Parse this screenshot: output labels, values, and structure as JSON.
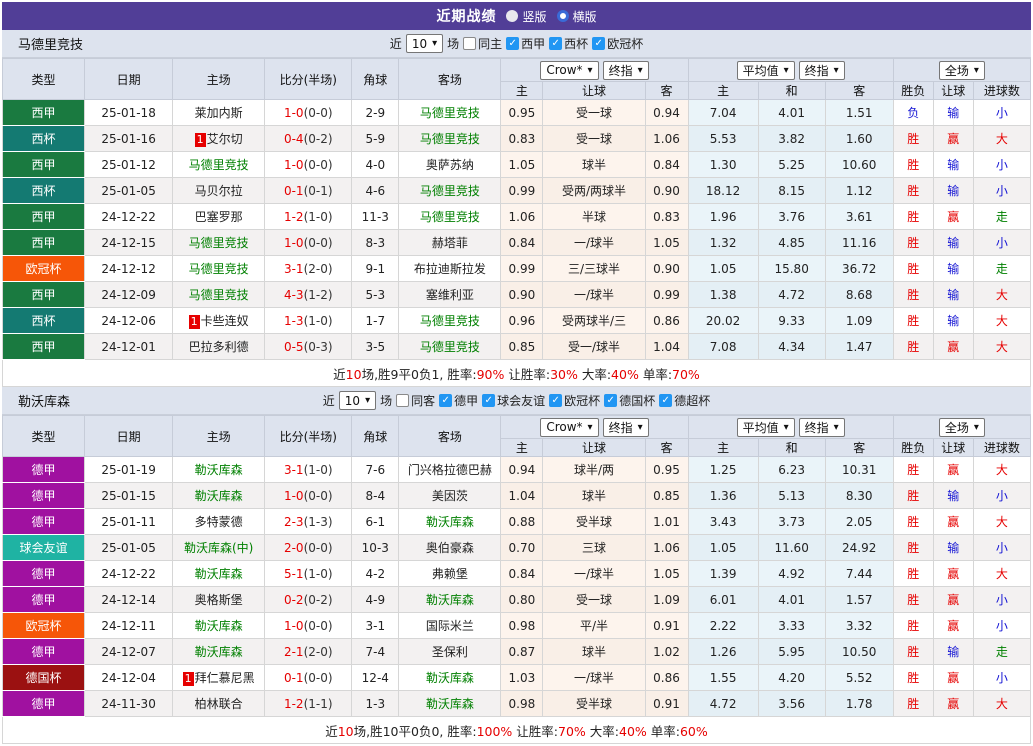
{
  "topbar": {
    "title": "近期战绩",
    "vertical_label": "竖版",
    "horizontal_label": "横版",
    "selected": "横版"
  },
  "filter": {
    "near": "近",
    "count": "10",
    "games": "场"
  },
  "table_header": {
    "type": "类型",
    "date": "日期",
    "home": "主场",
    "score": "比分(半场)",
    "corner": "角球",
    "away": "客场",
    "group1_select1": "Crow*",
    "group1_select2": "终指",
    "group2_select1": "平均值",
    "group2_select2": "终指",
    "group3_select": "全场",
    "sub": [
      "主",
      "让球",
      "客",
      "主",
      "和",
      "客",
      "胜负",
      "让球",
      "进球数"
    ]
  },
  "colors": {
    "accent_bar": "#513e97",
    "panel_bg": "#dde3ee",
    "checkbox_blue": "#2196f3",
    "score_red": "#e60000",
    "team_green": "#008000",
    "type_colors": {
      "西甲": "#1a7a40",
      "西杯": "#147a72",
      "欧冠杯": "#f65608",
      "德甲": "#a011a0",
      "球会友谊": "#1fb3a3",
      "德国杯": "#9b1111"
    },
    "result_colors": {
      "胜": "#e60000",
      "赢": "#e60000",
      "大": "#e60000",
      "负": "#1414d4",
      "输": "#1414d4",
      "小": "#1414d4",
      "走": "#008000",
      "平": "#008000"
    }
  },
  "sections": [
    {
      "team": "马德里竞技",
      "same_label": "同主",
      "same_checked": false,
      "leagues": [
        "西甲",
        "西杯",
        "欧冠杯"
      ],
      "rows": [
        {
          "league": "西甲",
          "date": "25-01-18",
          "home": "莱加内斯",
          "home_focus": false,
          "badge": "",
          "score": "1-0",
          "half": "(0-0)",
          "corner": "2-9",
          "away": "马德里竞技",
          "away_focus": true,
          "odds": [
            "0.95",
            "受一球",
            "0.94"
          ],
          "avg": [
            "7.04",
            "4.01",
            "1.51"
          ],
          "results": [
            "负",
            "输",
            "小"
          ]
        },
        {
          "league": "西杯",
          "date": "25-01-16",
          "home": "艾尔切",
          "home_focus": false,
          "badge": "1",
          "score": "0-4",
          "half": "(0-2)",
          "corner": "5-9",
          "away": "马德里竞技",
          "away_focus": true,
          "odds": [
            "0.83",
            "受一球",
            "1.06"
          ],
          "avg": [
            "5.53",
            "3.82",
            "1.60"
          ],
          "results": [
            "胜",
            "赢",
            "大"
          ]
        },
        {
          "league": "西甲",
          "date": "25-01-12",
          "home": "马德里竞技",
          "home_focus": true,
          "badge": "",
          "score": "1-0",
          "half": "(0-0)",
          "corner": "4-0",
          "away": "奥萨苏纳",
          "away_focus": false,
          "odds": [
            "1.05",
            "球半",
            "0.84"
          ],
          "avg": [
            "1.30",
            "5.25",
            "10.60"
          ],
          "results": [
            "胜",
            "输",
            "小"
          ]
        },
        {
          "league": "西杯",
          "date": "25-01-05",
          "home": "马贝尔拉",
          "home_focus": false,
          "badge": "",
          "score": "0-1",
          "half": "(0-1)",
          "corner": "4-6",
          "away": "马德里竞技",
          "away_focus": true,
          "odds": [
            "0.99",
            "受两/两球半",
            "0.90"
          ],
          "avg": [
            "18.12",
            "8.15",
            "1.12"
          ],
          "results": [
            "胜",
            "输",
            "小"
          ]
        },
        {
          "league": "西甲",
          "date": "24-12-22",
          "home": "巴塞罗那",
          "home_focus": false,
          "badge": "",
          "score": "1-2",
          "half": "(1-0)",
          "corner": "11-3",
          "away": "马德里竞技",
          "away_focus": true,
          "odds": [
            "1.06",
            "半球",
            "0.83"
          ],
          "avg": [
            "1.96",
            "3.76",
            "3.61"
          ],
          "results": [
            "胜",
            "赢",
            "走"
          ]
        },
        {
          "league": "西甲",
          "date": "24-12-15",
          "home": "马德里竞技",
          "home_focus": true,
          "badge": "",
          "score": "1-0",
          "half": "(0-0)",
          "corner": "8-3",
          "away": "赫塔菲",
          "away_focus": false,
          "odds": [
            "0.84",
            "一/球半",
            "1.05"
          ],
          "avg": [
            "1.32",
            "4.85",
            "11.16"
          ],
          "results": [
            "胜",
            "输",
            "小"
          ]
        },
        {
          "league": "欧冠杯",
          "date": "24-12-12",
          "home": "马德里竞技",
          "home_focus": true,
          "badge": "",
          "score": "3-1",
          "half": "(2-0)",
          "corner": "9-1",
          "away": "布拉迪斯拉发",
          "away_focus": false,
          "odds": [
            "0.99",
            "三/三球半",
            "0.90"
          ],
          "avg": [
            "1.05",
            "15.80",
            "36.72"
          ],
          "results": [
            "胜",
            "输",
            "走"
          ]
        },
        {
          "league": "西甲",
          "date": "24-12-09",
          "home": "马德里竞技",
          "home_focus": true,
          "badge": "",
          "score": "4-3",
          "half": "(1-2)",
          "corner": "5-3",
          "away": "塞维利亚",
          "away_focus": false,
          "odds": [
            "0.90",
            "一/球半",
            "0.99"
          ],
          "avg": [
            "1.38",
            "4.72",
            "8.68"
          ],
          "results": [
            "胜",
            "输",
            "大"
          ]
        },
        {
          "league": "西杯",
          "date": "24-12-06",
          "home": "卡些连奴",
          "home_focus": false,
          "badge": "1",
          "score": "1-3",
          "half": "(1-0)",
          "corner": "1-7",
          "away": "马德里竞技",
          "away_focus": true,
          "odds": [
            "0.96",
            "受两球半/三",
            "0.86"
          ],
          "avg": [
            "20.02",
            "9.33",
            "1.09"
          ],
          "results": [
            "胜",
            "输",
            "大"
          ]
        },
        {
          "league": "西甲",
          "date": "24-12-01",
          "home": "巴拉多利德",
          "home_focus": false,
          "badge": "",
          "score": "0-5",
          "half": "(0-3)",
          "corner": "3-5",
          "away": "马德里竞技",
          "away_focus": true,
          "odds": [
            "0.85",
            "受一/球半",
            "1.04"
          ],
          "avg": [
            "7.08",
            "4.34",
            "1.47"
          ],
          "results": [
            "胜",
            "赢",
            "大"
          ]
        }
      ],
      "summary_parts": [
        {
          "text": "近",
          "red": false
        },
        {
          "text": "10",
          "red": true
        },
        {
          "text": "场,胜9平0负1, 胜率:",
          "red": false
        },
        {
          "text": "90%",
          "red": true
        },
        {
          "text": " 让胜率:",
          "red": false
        },
        {
          "text": "30%",
          "red": true
        },
        {
          "text": " 大率:",
          "red": false
        },
        {
          "text": "40%",
          "red": true
        },
        {
          "text": " 单率:",
          "red": false
        },
        {
          "text": "70%",
          "red": true
        }
      ]
    },
    {
      "team": "勒沃库森",
      "same_label": "同客",
      "same_checked": false,
      "leagues": [
        "德甲",
        "球会友谊",
        "欧冠杯",
        "德国杯",
        "德超杯"
      ],
      "rows": [
        {
          "league": "德甲",
          "date": "25-01-19",
          "home": "勒沃库森",
          "home_focus": true,
          "badge": "",
          "score": "3-1",
          "half": "(1-0)",
          "corner": "7-6",
          "away": "门兴格拉德巴赫",
          "away_focus": false,
          "odds": [
            "0.94",
            "球半/两",
            "0.95"
          ],
          "avg": [
            "1.25",
            "6.23",
            "10.31"
          ],
          "results": [
            "胜",
            "赢",
            "大"
          ]
        },
        {
          "league": "德甲",
          "date": "25-01-15",
          "home": "勒沃库森",
          "home_focus": true,
          "badge": "",
          "score": "1-0",
          "half": "(0-0)",
          "corner": "8-4",
          "away": "美因茨",
          "away_focus": false,
          "odds": [
            "1.04",
            "球半",
            "0.85"
          ],
          "avg": [
            "1.36",
            "5.13",
            "8.30"
          ],
          "results": [
            "胜",
            "输",
            "小"
          ]
        },
        {
          "league": "德甲",
          "date": "25-01-11",
          "home": "多特蒙德",
          "home_focus": false,
          "badge": "",
          "score": "2-3",
          "half": "(1-3)",
          "corner": "6-1",
          "away": "勒沃库森",
          "away_focus": true,
          "odds": [
            "0.88",
            "受半球",
            "1.01"
          ],
          "avg": [
            "3.43",
            "3.73",
            "2.05"
          ],
          "results": [
            "胜",
            "赢",
            "大"
          ]
        },
        {
          "league": "球会友谊",
          "date": "25-01-05",
          "home": "勒沃库森(中)",
          "home_focus": true,
          "badge": "",
          "score": "2-0",
          "half": "(0-0)",
          "corner": "10-3",
          "away": "奥伯豪森",
          "away_focus": false,
          "odds": [
            "0.70",
            "三球",
            "1.06"
          ],
          "avg": [
            "1.05",
            "11.60",
            "24.92"
          ],
          "results": [
            "胜",
            "输",
            "小"
          ]
        },
        {
          "league": "德甲",
          "date": "24-12-22",
          "home": "勒沃库森",
          "home_focus": true,
          "badge": "",
          "score": "5-1",
          "half": "(1-0)",
          "corner": "4-2",
          "away": "弗赖堡",
          "away_focus": false,
          "odds": [
            "0.84",
            "一/球半",
            "1.05"
          ],
          "avg": [
            "1.39",
            "4.92",
            "7.44"
          ],
          "results": [
            "胜",
            "赢",
            "大"
          ]
        },
        {
          "league": "德甲",
          "date": "24-12-14",
          "home": "奥格斯堡",
          "home_focus": false,
          "badge": "",
          "score": "0-2",
          "half": "(0-2)",
          "corner": "4-9",
          "away": "勒沃库森",
          "away_focus": true,
          "odds": [
            "0.80",
            "受一球",
            "1.09"
          ],
          "avg": [
            "6.01",
            "4.01",
            "1.57"
          ],
          "results": [
            "胜",
            "赢",
            "小"
          ]
        },
        {
          "league": "欧冠杯",
          "date": "24-12-11",
          "home": "勒沃库森",
          "home_focus": true,
          "badge": "",
          "score": "1-0",
          "half": "(0-0)",
          "corner": "3-1",
          "away": "国际米兰",
          "away_focus": false,
          "odds": [
            "0.98",
            "平/半",
            "0.91"
          ],
          "avg": [
            "2.22",
            "3.33",
            "3.32"
          ],
          "results": [
            "胜",
            "赢",
            "小"
          ]
        },
        {
          "league": "德甲",
          "date": "24-12-07",
          "home": "勒沃库森",
          "home_focus": true,
          "badge": "",
          "score": "2-1",
          "half": "(2-0)",
          "corner": "7-4",
          "away": "圣保利",
          "away_focus": false,
          "odds": [
            "0.87",
            "球半",
            "1.02"
          ],
          "avg": [
            "1.26",
            "5.95",
            "10.50"
          ],
          "results": [
            "胜",
            "输",
            "走"
          ]
        },
        {
          "league": "德国杯",
          "date": "24-12-04",
          "home": "拜仁慕尼黑",
          "home_focus": false,
          "badge": "1",
          "score": "0-1",
          "half": "(0-0)",
          "corner": "12-4",
          "away": "勒沃库森",
          "away_focus": true,
          "odds": [
            "1.03",
            "一/球半",
            "0.86"
          ],
          "avg": [
            "1.55",
            "4.20",
            "5.52"
          ],
          "results": [
            "胜",
            "赢",
            "小"
          ]
        },
        {
          "league": "德甲",
          "date": "24-11-30",
          "home": "柏林联合",
          "home_focus": false,
          "badge": "",
          "score": "1-2",
          "half": "(1-1)",
          "corner": "1-3",
          "away": "勒沃库森",
          "away_focus": true,
          "odds": [
            "0.98",
            "受半球",
            "0.91"
          ],
          "avg": [
            "4.72",
            "3.56",
            "1.78"
          ],
          "results": [
            "胜",
            "赢",
            "大"
          ]
        }
      ],
      "summary_parts": [
        {
          "text": "近",
          "red": false
        },
        {
          "text": "10",
          "red": true
        },
        {
          "text": "场,胜10平0负0, 胜率:",
          "red": false
        },
        {
          "text": "100%",
          "red": true
        },
        {
          "text": " 让胜率:",
          "red": false
        },
        {
          "text": "70%",
          "red": true
        },
        {
          "text": " 大率:",
          "red": false
        },
        {
          "text": "40%",
          "red": true
        },
        {
          "text": " 单率:",
          "red": false
        },
        {
          "text": "60%",
          "red": true
        }
      ]
    }
  ]
}
